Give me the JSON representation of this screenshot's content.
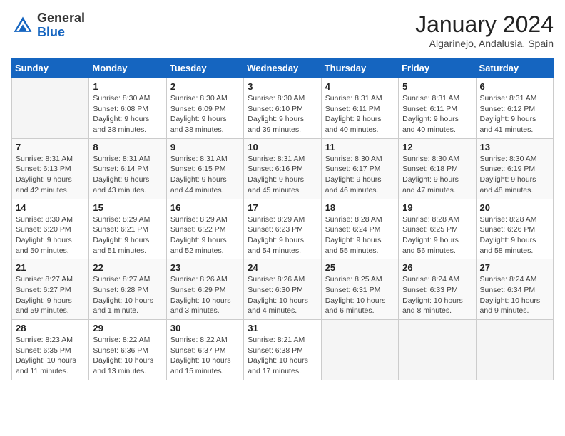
{
  "header": {
    "logo_general": "General",
    "logo_blue": "Blue",
    "month_title": "January 2024",
    "location": "Algarinejo, Andalusia, Spain"
  },
  "calendar": {
    "weekdays": [
      "Sunday",
      "Monday",
      "Tuesday",
      "Wednesday",
      "Thursday",
      "Friday",
      "Saturday"
    ],
    "weeks": [
      [
        {
          "day": "",
          "sunrise": "",
          "sunset": "",
          "daylight": ""
        },
        {
          "day": "1",
          "sunrise": "Sunrise: 8:30 AM",
          "sunset": "Sunset: 6:08 PM",
          "daylight": "Daylight: 9 hours and 38 minutes."
        },
        {
          "day": "2",
          "sunrise": "Sunrise: 8:30 AM",
          "sunset": "Sunset: 6:09 PM",
          "daylight": "Daylight: 9 hours and 38 minutes."
        },
        {
          "day": "3",
          "sunrise": "Sunrise: 8:30 AM",
          "sunset": "Sunset: 6:10 PM",
          "daylight": "Daylight: 9 hours and 39 minutes."
        },
        {
          "day": "4",
          "sunrise": "Sunrise: 8:31 AM",
          "sunset": "Sunset: 6:11 PM",
          "daylight": "Daylight: 9 hours and 40 minutes."
        },
        {
          "day": "5",
          "sunrise": "Sunrise: 8:31 AM",
          "sunset": "Sunset: 6:11 PM",
          "daylight": "Daylight: 9 hours and 40 minutes."
        },
        {
          "day": "6",
          "sunrise": "Sunrise: 8:31 AM",
          "sunset": "Sunset: 6:12 PM",
          "daylight": "Daylight: 9 hours and 41 minutes."
        }
      ],
      [
        {
          "day": "7",
          "sunrise": "Sunrise: 8:31 AM",
          "sunset": "Sunset: 6:13 PM",
          "daylight": "Daylight: 9 hours and 42 minutes."
        },
        {
          "day": "8",
          "sunrise": "Sunrise: 8:31 AM",
          "sunset": "Sunset: 6:14 PM",
          "daylight": "Daylight: 9 hours and 43 minutes."
        },
        {
          "day": "9",
          "sunrise": "Sunrise: 8:31 AM",
          "sunset": "Sunset: 6:15 PM",
          "daylight": "Daylight: 9 hours and 44 minutes."
        },
        {
          "day": "10",
          "sunrise": "Sunrise: 8:31 AM",
          "sunset": "Sunset: 6:16 PM",
          "daylight": "Daylight: 9 hours and 45 minutes."
        },
        {
          "day": "11",
          "sunrise": "Sunrise: 8:30 AM",
          "sunset": "Sunset: 6:17 PM",
          "daylight": "Daylight: 9 hours and 46 minutes."
        },
        {
          "day": "12",
          "sunrise": "Sunrise: 8:30 AM",
          "sunset": "Sunset: 6:18 PM",
          "daylight": "Daylight: 9 hours and 47 minutes."
        },
        {
          "day": "13",
          "sunrise": "Sunrise: 8:30 AM",
          "sunset": "Sunset: 6:19 PM",
          "daylight": "Daylight: 9 hours and 48 minutes."
        }
      ],
      [
        {
          "day": "14",
          "sunrise": "Sunrise: 8:30 AM",
          "sunset": "Sunset: 6:20 PM",
          "daylight": "Daylight: 9 hours and 50 minutes."
        },
        {
          "day": "15",
          "sunrise": "Sunrise: 8:29 AM",
          "sunset": "Sunset: 6:21 PM",
          "daylight": "Daylight: 9 hours and 51 minutes."
        },
        {
          "day": "16",
          "sunrise": "Sunrise: 8:29 AM",
          "sunset": "Sunset: 6:22 PM",
          "daylight": "Daylight: 9 hours and 52 minutes."
        },
        {
          "day": "17",
          "sunrise": "Sunrise: 8:29 AM",
          "sunset": "Sunset: 6:23 PM",
          "daylight": "Daylight: 9 hours and 54 minutes."
        },
        {
          "day": "18",
          "sunrise": "Sunrise: 8:28 AM",
          "sunset": "Sunset: 6:24 PM",
          "daylight": "Daylight: 9 hours and 55 minutes."
        },
        {
          "day": "19",
          "sunrise": "Sunrise: 8:28 AM",
          "sunset": "Sunset: 6:25 PM",
          "daylight": "Daylight: 9 hours and 56 minutes."
        },
        {
          "day": "20",
          "sunrise": "Sunrise: 8:28 AM",
          "sunset": "Sunset: 6:26 PM",
          "daylight": "Daylight: 9 hours and 58 minutes."
        }
      ],
      [
        {
          "day": "21",
          "sunrise": "Sunrise: 8:27 AM",
          "sunset": "Sunset: 6:27 PM",
          "daylight": "Daylight: 9 hours and 59 minutes."
        },
        {
          "day": "22",
          "sunrise": "Sunrise: 8:27 AM",
          "sunset": "Sunset: 6:28 PM",
          "daylight": "Daylight: 10 hours and 1 minute."
        },
        {
          "day": "23",
          "sunrise": "Sunrise: 8:26 AM",
          "sunset": "Sunset: 6:29 PM",
          "daylight": "Daylight: 10 hours and 3 minutes."
        },
        {
          "day": "24",
          "sunrise": "Sunrise: 8:26 AM",
          "sunset": "Sunset: 6:30 PM",
          "daylight": "Daylight: 10 hours and 4 minutes."
        },
        {
          "day": "25",
          "sunrise": "Sunrise: 8:25 AM",
          "sunset": "Sunset: 6:31 PM",
          "daylight": "Daylight: 10 hours and 6 minutes."
        },
        {
          "day": "26",
          "sunrise": "Sunrise: 8:24 AM",
          "sunset": "Sunset: 6:33 PM",
          "daylight": "Daylight: 10 hours and 8 minutes."
        },
        {
          "day": "27",
          "sunrise": "Sunrise: 8:24 AM",
          "sunset": "Sunset: 6:34 PM",
          "daylight": "Daylight: 10 hours and 9 minutes."
        }
      ],
      [
        {
          "day": "28",
          "sunrise": "Sunrise: 8:23 AM",
          "sunset": "Sunset: 6:35 PM",
          "daylight": "Daylight: 10 hours and 11 minutes."
        },
        {
          "day": "29",
          "sunrise": "Sunrise: 8:22 AM",
          "sunset": "Sunset: 6:36 PM",
          "daylight": "Daylight: 10 hours and 13 minutes."
        },
        {
          "day": "30",
          "sunrise": "Sunrise: 8:22 AM",
          "sunset": "Sunset: 6:37 PM",
          "daylight": "Daylight: 10 hours and 15 minutes."
        },
        {
          "day": "31",
          "sunrise": "Sunrise: 8:21 AM",
          "sunset": "Sunset: 6:38 PM",
          "daylight": "Daylight: 10 hours and 17 minutes."
        },
        {
          "day": "",
          "sunrise": "",
          "sunset": "",
          "daylight": ""
        },
        {
          "day": "",
          "sunrise": "",
          "sunset": "",
          "daylight": ""
        },
        {
          "day": "",
          "sunrise": "",
          "sunset": "",
          "daylight": ""
        }
      ]
    ]
  }
}
